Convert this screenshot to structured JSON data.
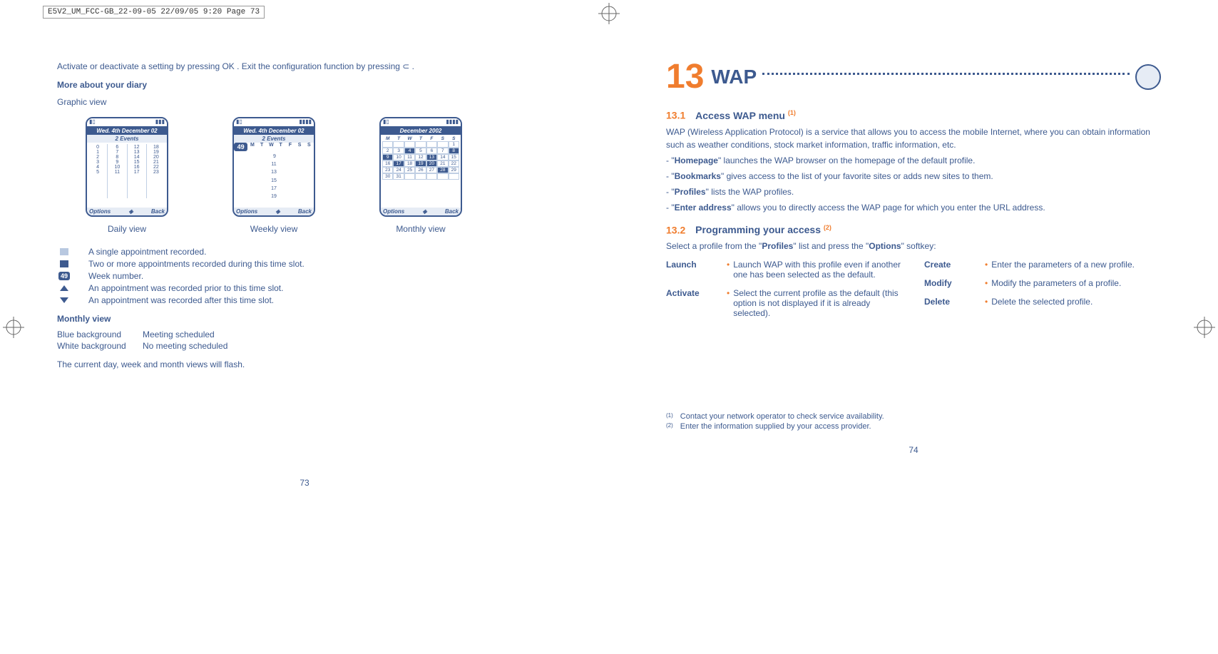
{
  "print_header": "E5V2_UM_FCC-GB_22-09-05  22/09/05  9:20  Page 73",
  "left": {
    "intro": "Activate or deactivate a setting by pressing OK . Exit the configuration function by pressing ⊂ .",
    "more_title": "More about your diary",
    "graphic_view": "Graphic view",
    "screens": {
      "daily": {
        "title": "Wed. 4th December 02",
        "sub": "2 Events",
        "opt": "Options",
        "back": "Back",
        "label": "Daily view"
      },
      "weekly": {
        "title": "Wed. 4th December 02",
        "sub": "2 Events",
        "wk": "49",
        "days": "M T W T F S S",
        "opt": "Options",
        "back": "Back",
        "label": "Weekly view"
      },
      "monthly": {
        "title": "December 2002",
        "days": "M T W T F S S",
        "opt": "Options",
        "back": "Back",
        "label": "Monthly view"
      }
    },
    "legend": {
      "single": "A single appointment recorded.",
      "multi": "Two or more appointments recorded during this time slot.",
      "week_no": "Week number.",
      "wk_badge": "49",
      "prior": "An appointment was recorded prior to this time slot.",
      "after": "An appointment was recorded after this time slot."
    },
    "monthly_view": {
      "title": "Monthly view",
      "blue_l": "Blue background",
      "blue_v": "Meeting scheduled",
      "white_l": "White background",
      "white_v": "No meeting scheduled"
    },
    "flash": "The current day, week and month views will flash.",
    "page_no": "73"
  },
  "right": {
    "chapter_no": "13",
    "chapter_title": "WAP",
    "sec1_no": "13.1",
    "sec1_title": "Access WAP menu",
    "sec1_fn": "(1)",
    "intro": "WAP (Wireless Application Protocol) is a service that allows you to access the mobile Internet, where you can obtain information such as weather conditions, stock market information, traffic information, etc.",
    "items": {
      "homepage": "- \"Homepage\" launches the WAP browser on the homepage of the default profile.",
      "bookmarks": "- \"Bookmarks\" gives access to the list of your favorite sites or adds new sites to them.",
      "profiles": "- \"Profiles\" lists the WAP profiles.",
      "enter": "- \"Enter address\" allows you to directly access the WAP page for which you enter the URL address."
    },
    "sec2_no": "13.2",
    "sec2_title": "Programming your access",
    "sec2_fn": "(2)",
    "sec2_intro": "Select a profile from the \"Profiles\" list and press the \"Options\" softkey:",
    "opts_left": {
      "launch_l": "Launch",
      "launch_d": "Launch WAP with this profile even if another one has been selected as the default.",
      "activate_l": "Activate",
      "activate_d": "Select the current profile as the default (this option is not displayed if it is already selected)."
    },
    "opts_right": {
      "create_l": "Create",
      "create_d": "Enter the parameters of a new profile.",
      "modify_l": "Modify",
      "modify_d": "Modify the parameters of a profile.",
      "delete_l": "Delete",
      "delete_d": "Delete the selected profile."
    },
    "footnotes": {
      "f1_n": "(1)",
      "f1_t": "Contact your network operator to check service availability.",
      "f2_n": "(2)",
      "f2_t": "Enter the information supplied by your access provider."
    },
    "page_no": "74"
  }
}
